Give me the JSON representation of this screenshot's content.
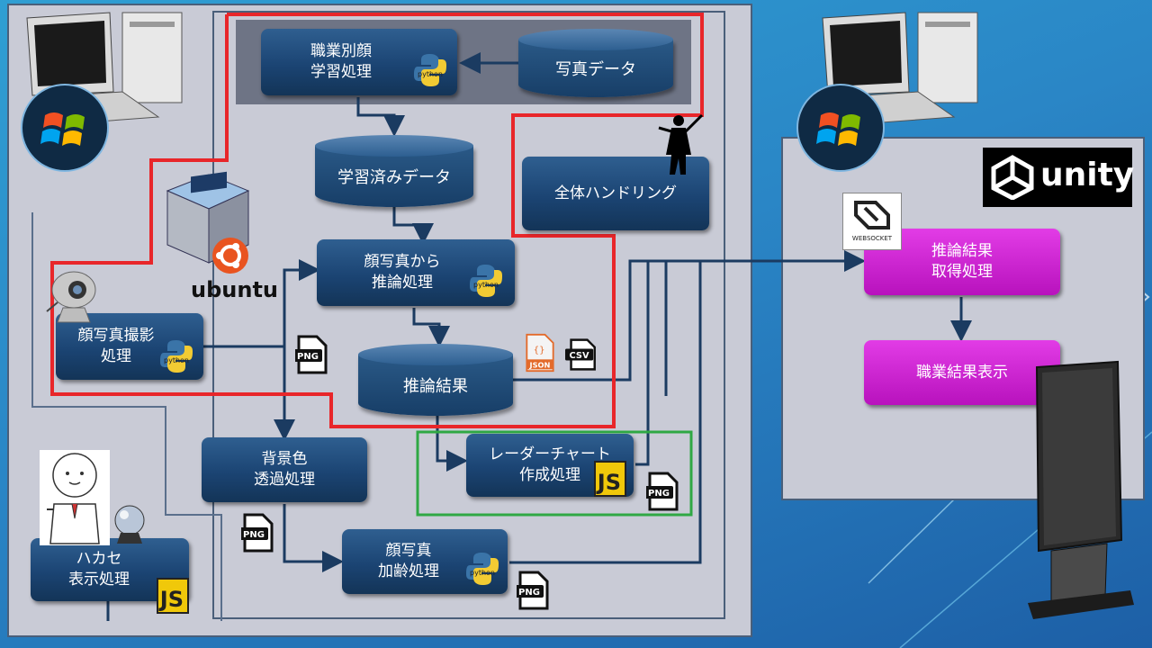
{
  "nodes": {
    "job_face_learning": "職業別顔\n学習処理",
    "photo_data": "写真データ",
    "learned_data": "学習済みデータ",
    "overall_handling": "全体ハンドリング",
    "inference_from_face": "顔写真から\n推論処理",
    "face_capture": "顔写真撮影\n処理",
    "inference_result": "推論結果",
    "radar_chart": "レーダーチャート\n作成処理",
    "background_transparency": "背景色\n透過処理",
    "hakase_display": "ハカセ\n表示処理",
    "face_aging": "顔写真\n加齢処理",
    "inference_fetch": "推論結果\n取得処理",
    "job_result_display": "職業結果表示"
  },
  "labels": {
    "ubuntu": "ubuntu",
    "unity": "unity",
    "websocket": "WEBSOCKET",
    "png": "PNG",
    "json": "JSON",
    "csv": "CSV",
    "js": "JS",
    "python": "python"
  },
  "colors": {
    "red_frame": "#e8262a",
    "green_frame": "#2fa844",
    "box_blue": "#1b4473",
    "box_magenta": "#c21ec7",
    "arrow": "#1b3b61"
  },
  "icons": [
    "windows-icon",
    "desktop-pc-icon",
    "virtualbox-icon",
    "ubuntu-logo-icon",
    "webcam-icon",
    "conductor-icon",
    "python-icon",
    "javascript-icon",
    "png-file-icon",
    "json-file-icon",
    "csv-file-icon",
    "unity-logo-icon",
    "websocket-icon",
    "hakase-character-icon",
    "crystal-ball-icon",
    "digital-signage-display-icon"
  ]
}
